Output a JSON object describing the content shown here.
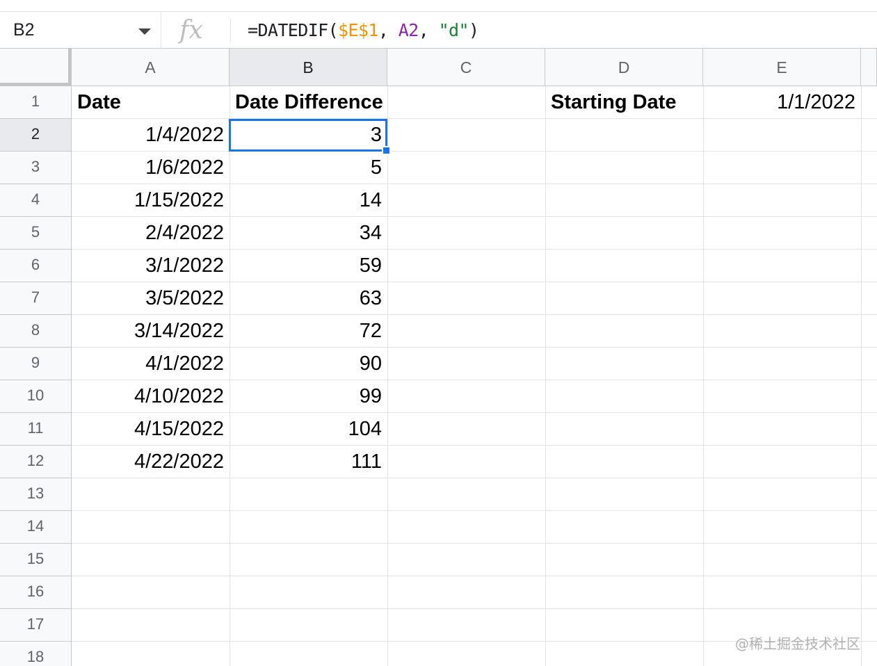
{
  "formula_bar": {
    "name_box": "B2",
    "fx_label": "fx",
    "formula_parts": {
      "prefix": "=DATEDIF(",
      "ref1": "$E$1",
      "sep1": ", ",
      "ref2": "A2",
      "sep2": ", ",
      "str": "\"d\"",
      "suffix": ")"
    }
  },
  "columns": [
    "A",
    "B",
    "C",
    "D",
    "E"
  ],
  "selected_cell": "B2",
  "row_numbers": [
    "1",
    "2",
    "3",
    "4",
    "5",
    "6",
    "7",
    "8",
    "9",
    "10",
    "11",
    "12",
    "13",
    "14",
    "15",
    "16",
    "17",
    "18"
  ],
  "cells": {
    "A1": "Date",
    "B1": "Date Difference",
    "D1": "Starting Date",
    "E1": "1/1/2022",
    "A": [
      "1/4/2022",
      "1/6/2022",
      "1/15/2022",
      "2/4/2022",
      "3/1/2022",
      "3/5/2022",
      "3/14/2022",
      "4/1/2022",
      "4/10/2022",
      "4/15/2022",
      "4/22/2022"
    ],
    "B": [
      "3",
      "5",
      "14",
      "34",
      "59",
      "63",
      "72",
      "90",
      "99",
      "104",
      "111"
    ]
  },
  "watermark": "@稀土掘金技术社区",
  "colors": {
    "selection": "#1a73e8",
    "ref1": "#f09300",
    "ref2": "#8e24aa",
    "string": "#188038"
  }
}
